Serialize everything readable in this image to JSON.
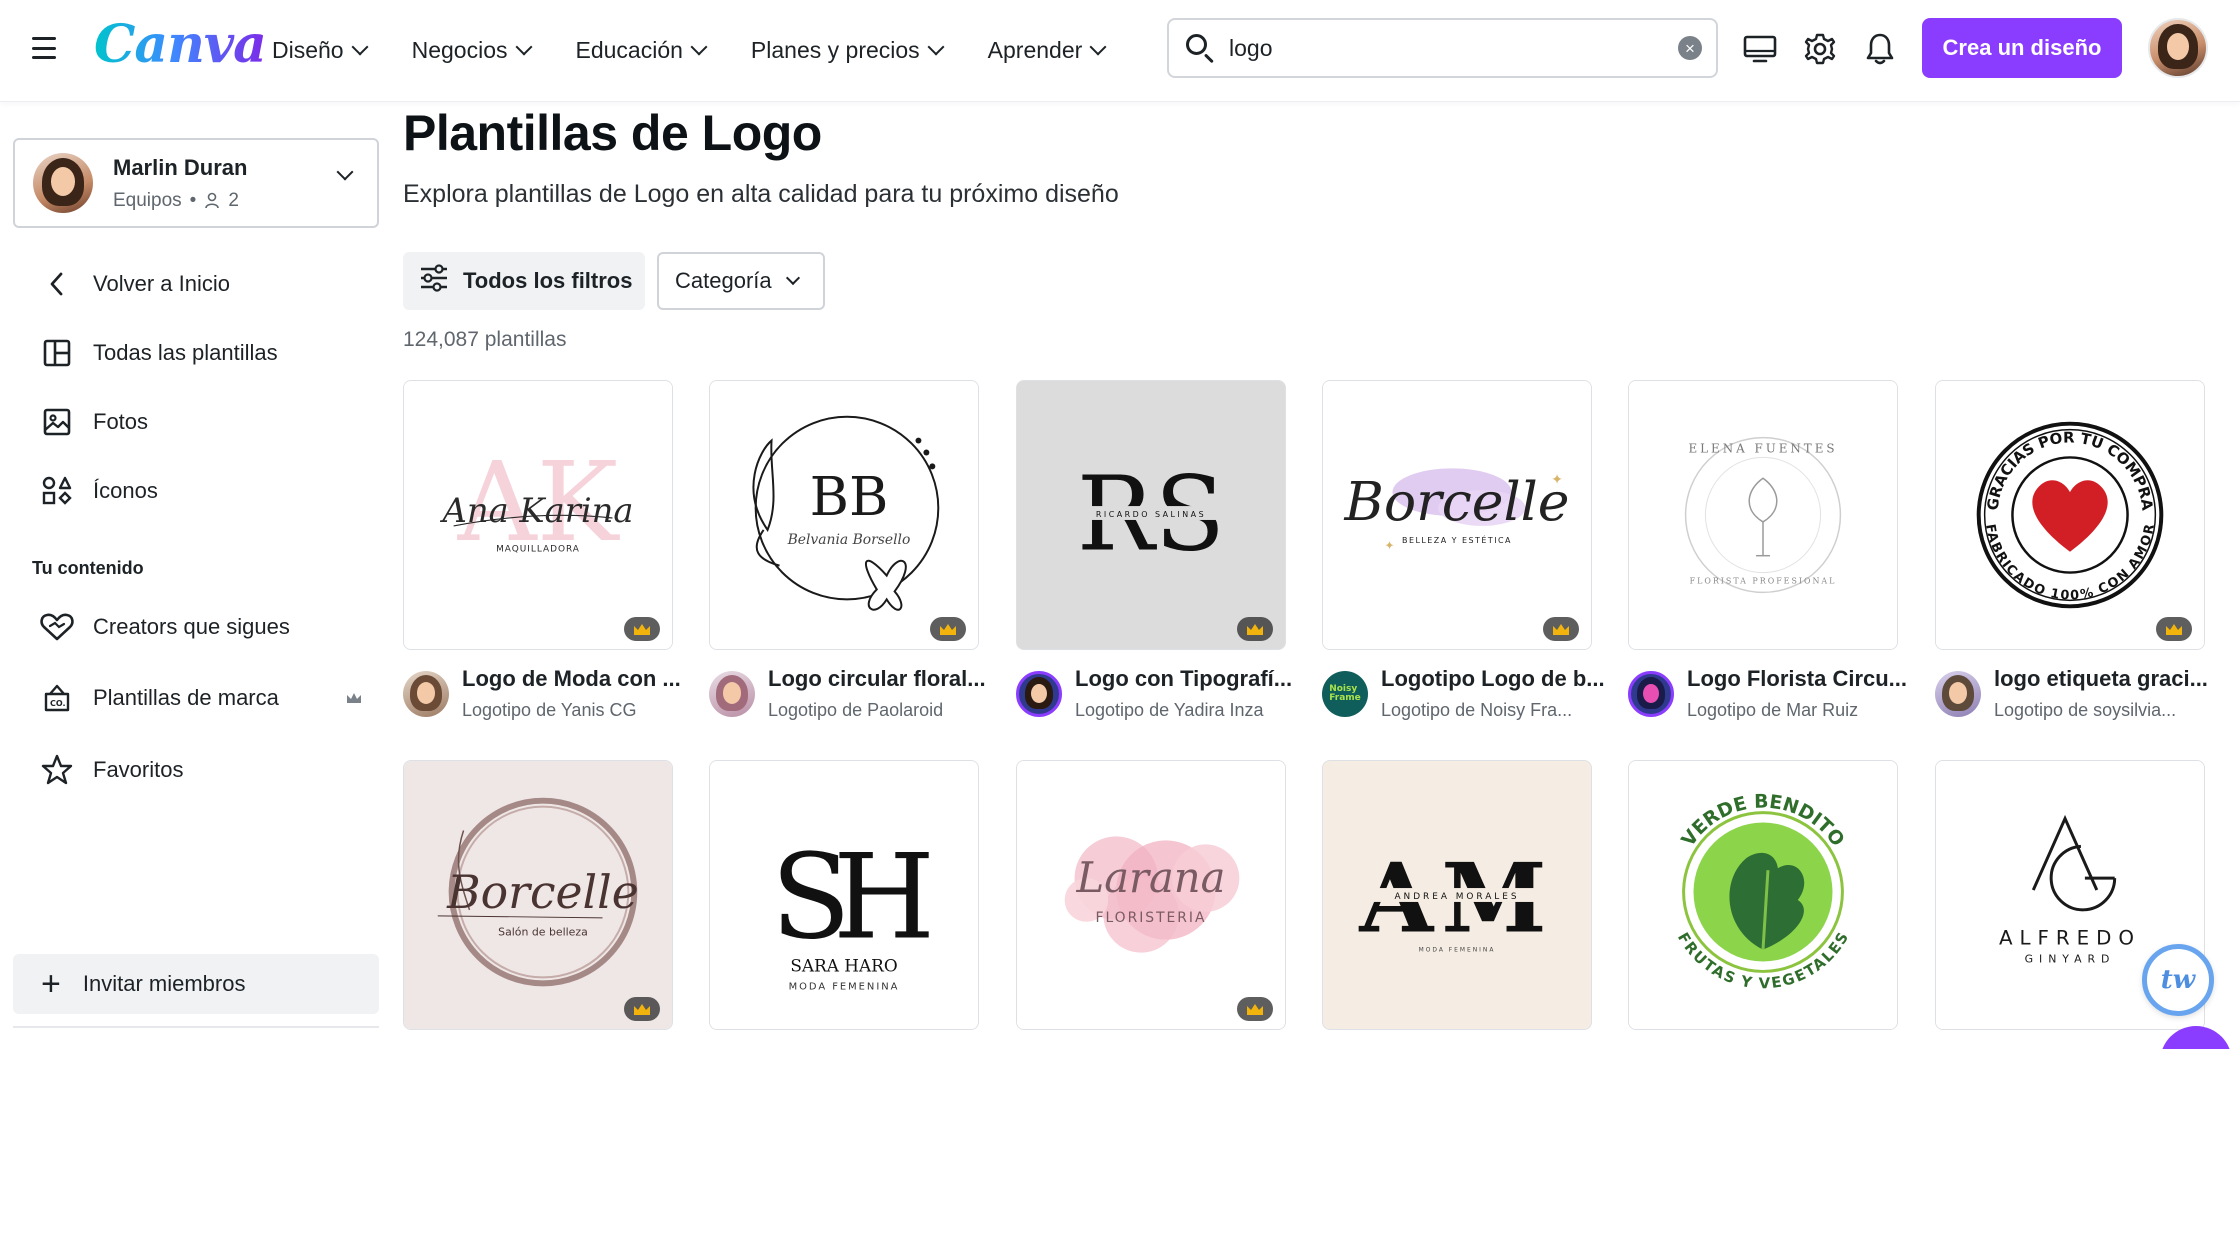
{
  "header": {
    "logo_text": "Canva",
    "nav": [
      "Diseño",
      "Negocios",
      "Educación",
      "Planes y precios",
      "Aprender"
    ],
    "search_value": "logo",
    "cta_label": "Crea un diseño"
  },
  "sidebar": {
    "team_name": "Marlin Duran",
    "team_type": "Equipos",
    "team_members": "2",
    "items": [
      {
        "label": "Volver a Inicio",
        "icon": "chevron-left-icon"
      },
      {
        "label": "Todas las plantillas",
        "icon": "templates-icon"
      },
      {
        "label": "Fotos",
        "icon": "photo-icon"
      },
      {
        "label": "Íconos",
        "icon": "shapes-icon"
      }
    ],
    "section_heading": "Tu contenido",
    "content_items": [
      {
        "label": "Creators que sigues",
        "icon": "heart-icon"
      },
      {
        "label": "Plantillas de marca",
        "icon": "brand-kit-icon"
      },
      {
        "label": "Favoritos",
        "icon": "star-icon"
      }
    ],
    "invite_label": "Invitar miembros"
  },
  "main": {
    "title": "Plantillas de Logo",
    "subtitle": "Explora plantillas de Logo en alta calidad para tu próximo diseño",
    "filters_label": "Todos los filtros",
    "category_label": "Categoría",
    "count_text": "124,087 plantillas"
  },
  "templates": [
    {
      "title": "Logo de Moda con ...",
      "author": "Logotipo de Yanis CG",
      "logo_text": "Ana Karina",
      "logo_sub": "MAQUILLADORA",
      "premium": true
    },
    {
      "title": "Logo circular floral...",
      "author": "Logotipo de Paolaroid",
      "logo_text": "BB",
      "logo_sub": "Belvania Borsello",
      "premium": true
    },
    {
      "title": "Logo con Tipografí...",
      "author": "Logotipo de Yadira Inza",
      "logo_text": "RS",
      "logo_sub": "RICARDO SALINAS",
      "premium": true
    },
    {
      "title": "Logotipo Logo de b...",
      "author": "Logotipo de Noisy Fra...",
      "logo_text": "Borcelle",
      "logo_sub": "BELLEZA Y ESTÉTICA",
      "premium": true
    },
    {
      "title": "Logo Florista Circu...",
      "author": "Logotipo de Mar Ruiz",
      "logo_text": "ELENA FUENTES",
      "logo_sub": "FLORISTA PROFESIONAL",
      "premium": false
    },
    {
      "title": "logo etiqueta graci...",
      "author": "Logotipo de soysilvia...",
      "logo_text": "GRACIAS POR TU COMPRA",
      "logo_sub": "FABRICADO 100% CON AMOR",
      "premium": true
    },
    {
      "logo_text": "Borcelle",
      "logo_sub": "Salón de belleza",
      "premium": true
    },
    {
      "logo_text": "SH",
      "logo_sub": "SARA HARO",
      "logo_sub2": "MODA FEMENINA",
      "premium": false
    },
    {
      "logo_text": "Larana",
      "logo_sub": "FLORISTERIA",
      "premium": true
    },
    {
      "logo_text": "AM",
      "logo_sub": "ANDREA MORALES",
      "logo_sub2": "MODA FEMENINA",
      "premium": false
    },
    {
      "logo_text": "VERDE BENDITO",
      "logo_sub": "FRUTAS Y VEGETALES",
      "premium": false
    },
    {
      "logo_text": "AG",
      "logo_sub": "ALFREDO",
      "logo_sub2": "GINYARD",
      "premium": false
    }
  ],
  "floating": {
    "badge_text": "tw"
  },
  "colors": {
    "brand_purple": "#8b3dff",
    "crown_gold": "#f2b40c"
  }
}
